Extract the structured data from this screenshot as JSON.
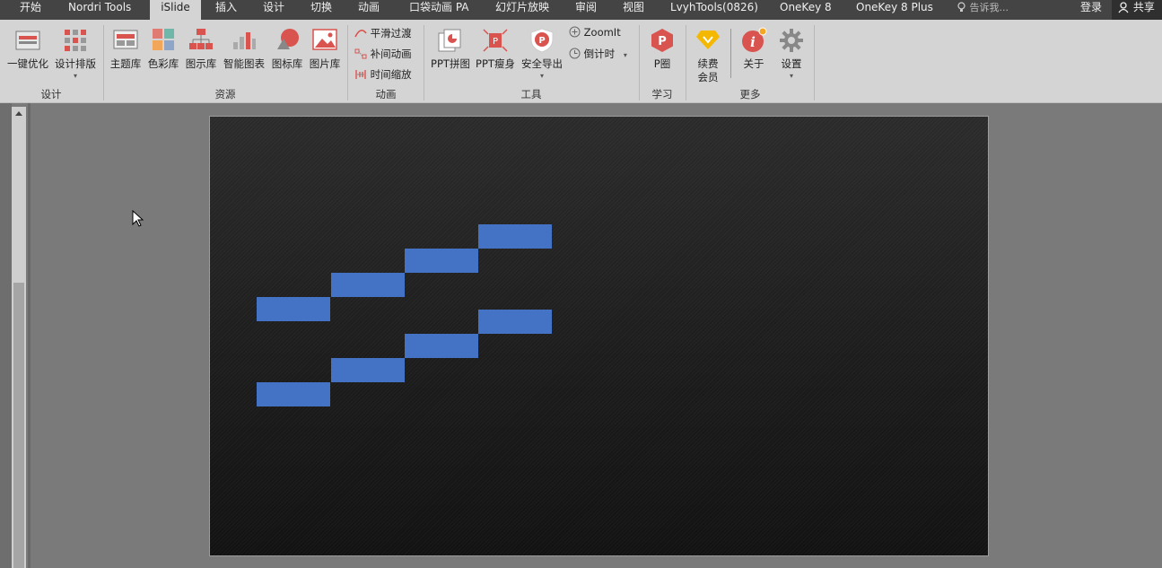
{
  "tabs": [
    "开始",
    "Nordri Tools",
    "iSlide",
    "插入",
    "设计",
    "切换",
    "动画",
    "口袋动画 PA",
    "幻灯片放映",
    "审阅",
    "视图",
    "LvyhTools(0826)",
    "OneKey 8",
    "OneKey 8 Plus"
  ],
  "active_tab": "iSlide",
  "tell_me": "告诉我...",
  "login": "登录",
  "share": "共享",
  "ribbon": {
    "design": {
      "one_click": "一键优化",
      "layout": "设计排版",
      "group": "设计"
    },
    "resources": {
      "theme": "主题库",
      "color": "色彩库",
      "diagram": "图示库",
      "smart_chart": "智能图表",
      "icon": "图标库",
      "picture": "图片库",
      "group": "资源"
    },
    "animation": {
      "smooth": "平滑过渡",
      "tween": "补间动画",
      "time_scale": "时间缩放",
      "group": "动画"
    },
    "tools": {
      "collage": "PPT拼图",
      "slim": "PPT瘦身",
      "safe_export": "安全导出",
      "zoomit": "ZoomIt",
      "countdown": "倒计时",
      "group": "工具"
    },
    "learn": {
      "pcircle": "P圈",
      "group": "学习"
    },
    "more": {
      "renew": "续费",
      "member": "会员",
      "about": "关于",
      "settings": "设置",
      "group": "更多"
    }
  },
  "colors": {
    "tabbar": "#444444",
    "ribbon": "#d4d4d4",
    "workspace": "#7a7a7a",
    "rect": "#4472c4"
  }
}
